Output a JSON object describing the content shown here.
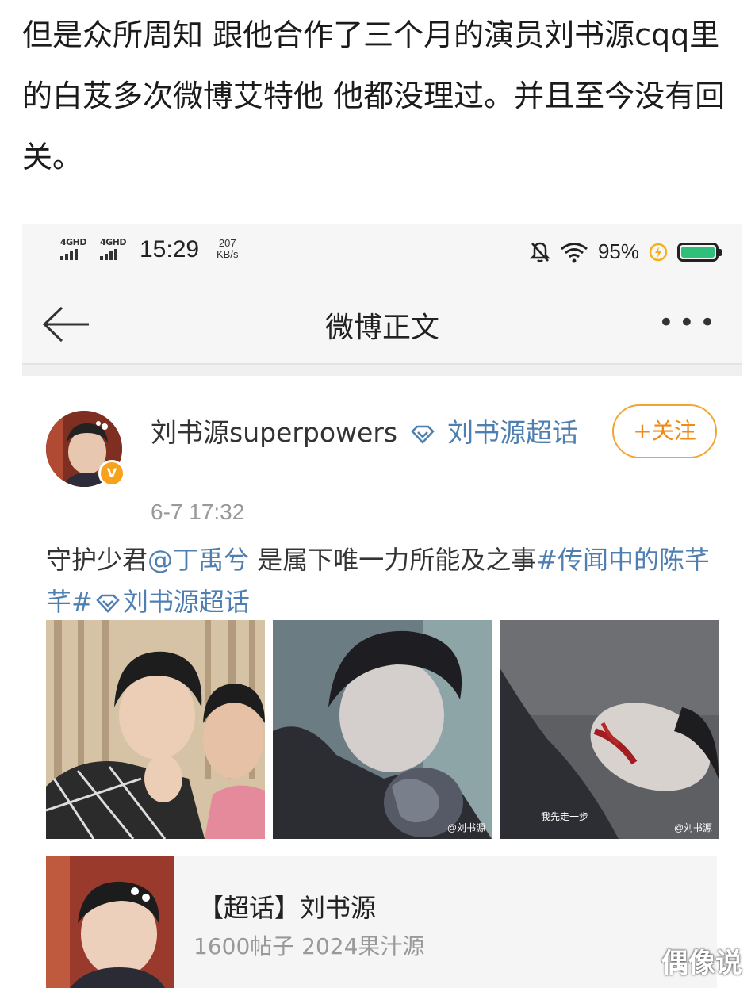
{
  "intro_text": "但是众所周知 跟他合作了三个月的演员刘书源cqq里的白芨多次微博艾特他 他都没理过。并且至今没有回关。",
  "status_bar": {
    "network_1": "4GHD",
    "network_2": "4GHD",
    "time": "15:29",
    "speed_value": "207",
    "speed_unit": "KB/s",
    "battery": "95%",
    "icons": [
      "mute-bell-icon",
      "wifi-icon",
      "charging-icon",
      "battery-icon"
    ]
  },
  "nav": {
    "title": "微博正文",
    "back_icon": "back-arrow-icon",
    "more_icon": "more-dots-icon"
  },
  "post": {
    "username": "刘书源superpowers",
    "topic_label": "刘书源超话",
    "follow_label": "+关注",
    "time": "6-7 17:32",
    "text_plain_1": "守护少君",
    "mention": "@丁禹兮",
    "text_plain_2": " 是属下唯一力所能及之事",
    "hashtag": "#传闻中的陈芊芊#",
    "supertopic_link": "刘书源超话",
    "photo_watermark_2": "@刘书源",
    "photo_caption_3": "我先走一步",
    "photo_watermark_3": "@刘书源"
  },
  "card": {
    "title": "【超话】刘书源",
    "subtitle": "1600帖子 2024果汁源"
  },
  "image_watermark": "偶像说",
  "colors": {
    "link_blue": "#4f7fb0",
    "follow_orange": "#f08a17",
    "battery_green": "#2fbf7a",
    "vip_badge": "#f7a21b"
  }
}
